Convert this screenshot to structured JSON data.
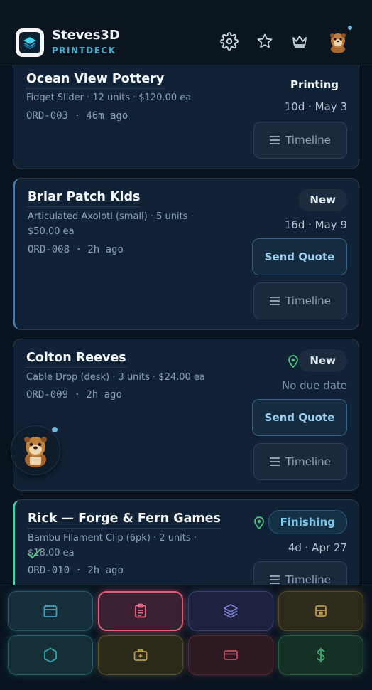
{
  "app": {
    "title": "Steves3D",
    "subtitle": "PRINTDECK"
  },
  "header": {
    "icons": [
      "gear-icon",
      "star-icon",
      "crown-icon",
      "otter-avatar-icon"
    ],
    "has_notification": true
  },
  "orders": [
    {
      "customer": "Ocean View Pottery",
      "desc": "Fidget Slider · 12 units · $120.00 ea",
      "order_id": "ORD-003",
      "age": "46m ago",
      "status": "Printing",
      "due": "10d · May 3",
      "timeline_label": "Timeline"
    },
    {
      "customer": "Briar Patch Kids",
      "desc_line1": "Articulated Axolotl (small) · 5 units ·",
      "desc_line2": "$50.00 ea",
      "order_id": "ORD-008",
      "age": "2h ago",
      "status": "New",
      "due": "16d · May 9",
      "quote_label": "Send Quote",
      "timeline_label": "Timeline"
    },
    {
      "customer": "Colton Reeves",
      "desc": "Cable Drop (desk) · 3 units · $24.00 ea",
      "order_id": "ORD-009",
      "age": "2h ago",
      "status": "New",
      "due": "No due date",
      "quote_label": "Send Quote",
      "timeline_label": "Timeline"
    },
    {
      "customer": "Rick — Forge & Fern Games",
      "desc_line1": "Bambu Filament Clip (6pk) · 2 units ·",
      "desc_line2": "$18.00 ea",
      "order_id": "ORD-010",
      "age": "2h ago",
      "status": "Finishing",
      "due": "4d · Apr 27",
      "timeline_label": "Timeline"
    }
  ],
  "dock": {
    "buttons": [
      {
        "icon": "calendar-icon",
        "color": "#3a8aa8"
      },
      {
        "icon": "clipboard-icon",
        "color": "#e0607a",
        "active": true
      },
      {
        "icon": "layers-icon",
        "color": "#6a70c0"
      },
      {
        "icon": "archive-icon",
        "color": "#b08a40"
      },
      {
        "icon": "hexagon-icon",
        "color": "#2a9aa0"
      },
      {
        "icon": "toolbox-icon",
        "color": "#a89040"
      },
      {
        "icon": "card-icon",
        "color": "#a84050"
      },
      {
        "icon": "dollar-icon",
        "color": "#3a9a68"
      }
    ]
  },
  "colors": {
    "background": "#0a1420",
    "card": "#112236",
    "accent": "#4aa8c8",
    "finishing": "#7cc8ec",
    "pin": "#4ec080"
  }
}
